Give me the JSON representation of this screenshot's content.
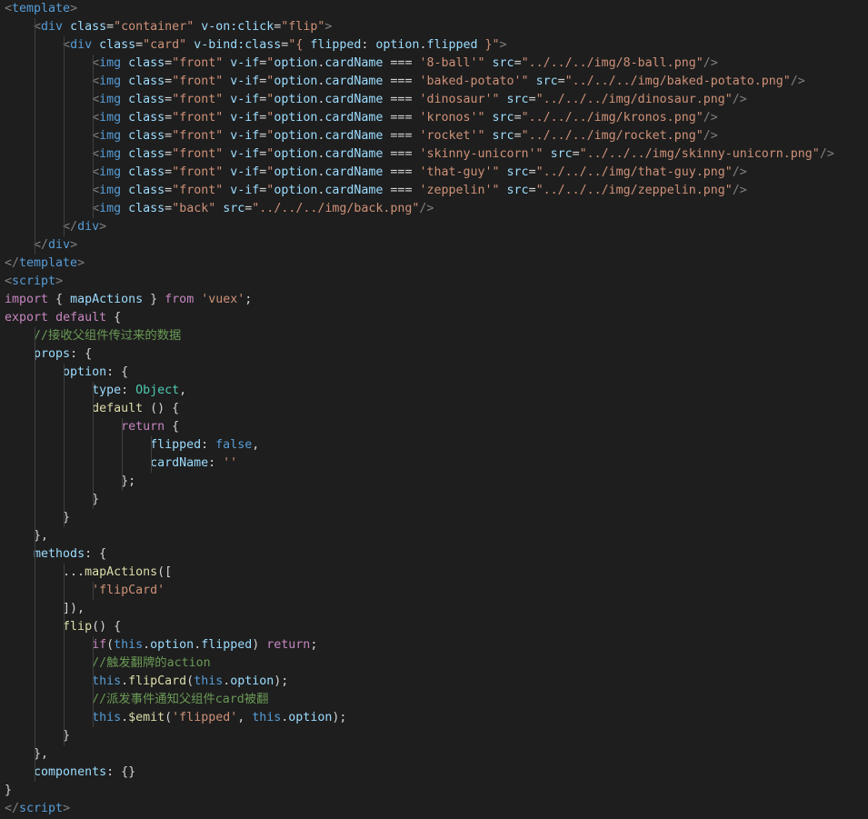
{
  "editor": {
    "theme": "dark",
    "background": "#1e1e1e",
    "lines": [
      [
        {
          "t": "<",
          "c": "p"
        },
        {
          "t": "template",
          "c": "k"
        },
        {
          "t": ">",
          "c": "p"
        }
      ],
      [
        {
          "t": "    "
        },
        {
          "t": "<",
          "c": "p"
        },
        {
          "t": "div",
          "c": "k"
        },
        {
          "t": " "
        },
        {
          "t": "class",
          "c": "a"
        },
        {
          "t": "="
        },
        {
          "t": "\"container\"",
          "c": "s"
        },
        {
          "t": " "
        },
        {
          "t": "v-on:click",
          "c": "a"
        },
        {
          "t": "="
        },
        {
          "t": "\"flip\"",
          "c": "s"
        },
        {
          "t": ">",
          "c": "p"
        }
      ],
      [
        {
          "t": "        "
        },
        {
          "t": "<",
          "c": "p"
        },
        {
          "t": "div",
          "c": "k"
        },
        {
          "t": " "
        },
        {
          "t": "class",
          "c": "a"
        },
        {
          "t": "="
        },
        {
          "t": "\"card\"",
          "c": "s"
        },
        {
          "t": " "
        },
        {
          "t": "v-bind:class",
          "c": "a"
        },
        {
          "t": "="
        },
        {
          "t": "\"{ ",
          "c": "s"
        },
        {
          "t": "flipped",
          "c": "a"
        },
        {
          "t": ": ",
          "c": "d"
        },
        {
          "t": "option",
          "c": "a"
        },
        {
          "t": ".",
          "c": "d"
        },
        {
          "t": "flipped",
          "c": "a"
        },
        {
          "t": " }\"",
          "c": "s"
        },
        {
          "t": ">",
          "c": "p"
        }
      ],
      [
        {
          "t": "            "
        },
        {
          "t": "<",
          "c": "p"
        },
        {
          "t": "img",
          "c": "k"
        },
        {
          "t": " "
        },
        {
          "t": "class",
          "c": "a"
        },
        {
          "t": "="
        },
        {
          "t": "\"front\"",
          "c": "s"
        },
        {
          "t": " "
        },
        {
          "t": "v-if",
          "c": "a"
        },
        {
          "t": "="
        },
        {
          "t": "\"",
          "c": "s"
        },
        {
          "t": "option",
          "c": "a"
        },
        {
          "t": "."
        },
        {
          "t": "cardName",
          "c": "a"
        },
        {
          "t": " === "
        },
        {
          "t": "'8-ball'",
          "c": "s"
        },
        {
          "t": "\"",
          "c": "s"
        },
        {
          "t": " "
        },
        {
          "t": "src",
          "c": "a"
        },
        {
          "t": "="
        },
        {
          "t": "\"../../../img/8-ball.png\"",
          "c": "s"
        },
        {
          "t": "/>",
          "c": "p"
        }
      ],
      [
        {
          "t": "            "
        },
        {
          "t": "<",
          "c": "p"
        },
        {
          "t": "img",
          "c": "k"
        },
        {
          "t": " "
        },
        {
          "t": "class",
          "c": "a"
        },
        {
          "t": "="
        },
        {
          "t": "\"front\"",
          "c": "s"
        },
        {
          "t": " "
        },
        {
          "t": "v-if",
          "c": "a"
        },
        {
          "t": "="
        },
        {
          "t": "\"",
          "c": "s"
        },
        {
          "t": "option",
          "c": "a"
        },
        {
          "t": "."
        },
        {
          "t": "cardName",
          "c": "a"
        },
        {
          "t": " === "
        },
        {
          "t": "'baked-potato'",
          "c": "s"
        },
        {
          "t": "\"",
          "c": "s"
        },
        {
          "t": " "
        },
        {
          "t": "src",
          "c": "a"
        },
        {
          "t": "="
        },
        {
          "t": "\"../../../img/baked-potato.png\"",
          "c": "s"
        },
        {
          "t": "/>",
          "c": "p"
        }
      ],
      [
        {
          "t": "            "
        },
        {
          "t": "<",
          "c": "p"
        },
        {
          "t": "img",
          "c": "k"
        },
        {
          "t": " "
        },
        {
          "t": "class",
          "c": "a"
        },
        {
          "t": "="
        },
        {
          "t": "\"front\"",
          "c": "s"
        },
        {
          "t": " "
        },
        {
          "t": "v-if",
          "c": "a"
        },
        {
          "t": "="
        },
        {
          "t": "\"",
          "c": "s"
        },
        {
          "t": "option",
          "c": "a"
        },
        {
          "t": "."
        },
        {
          "t": "cardName",
          "c": "a"
        },
        {
          "t": " === "
        },
        {
          "t": "'dinosaur'",
          "c": "s"
        },
        {
          "t": "\"",
          "c": "s"
        },
        {
          "t": " "
        },
        {
          "t": "src",
          "c": "a"
        },
        {
          "t": "="
        },
        {
          "t": "\"../../../img/dinosaur.png\"",
          "c": "s"
        },
        {
          "t": "/>",
          "c": "p"
        }
      ],
      [
        {
          "t": "            "
        },
        {
          "t": "<",
          "c": "p"
        },
        {
          "t": "img",
          "c": "k"
        },
        {
          "t": " "
        },
        {
          "t": "class",
          "c": "a"
        },
        {
          "t": "="
        },
        {
          "t": "\"front\"",
          "c": "s"
        },
        {
          "t": " "
        },
        {
          "t": "v-if",
          "c": "a"
        },
        {
          "t": "="
        },
        {
          "t": "\"",
          "c": "s"
        },
        {
          "t": "option",
          "c": "a"
        },
        {
          "t": "."
        },
        {
          "t": "cardName",
          "c": "a"
        },
        {
          "t": " === "
        },
        {
          "t": "'kronos'",
          "c": "s"
        },
        {
          "t": "\"",
          "c": "s"
        },
        {
          "t": " "
        },
        {
          "t": "src",
          "c": "a"
        },
        {
          "t": "="
        },
        {
          "t": "\"../../../img/kronos.png\"",
          "c": "s"
        },
        {
          "t": "/>",
          "c": "p"
        }
      ],
      [
        {
          "t": "            "
        },
        {
          "t": "<",
          "c": "p"
        },
        {
          "t": "img",
          "c": "k"
        },
        {
          "t": " "
        },
        {
          "t": "class",
          "c": "a"
        },
        {
          "t": "="
        },
        {
          "t": "\"front\"",
          "c": "s"
        },
        {
          "t": " "
        },
        {
          "t": "v-if",
          "c": "a"
        },
        {
          "t": "="
        },
        {
          "t": "\"",
          "c": "s"
        },
        {
          "t": "option",
          "c": "a"
        },
        {
          "t": "."
        },
        {
          "t": "cardName",
          "c": "a"
        },
        {
          "t": " === "
        },
        {
          "t": "'rocket'",
          "c": "s"
        },
        {
          "t": "\"",
          "c": "s"
        },
        {
          "t": " "
        },
        {
          "t": "src",
          "c": "a"
        },
        {
          "t": "="
        },
        {
          "t": "\"../../../img/rocket.png\"",
          "c": "s"
        },
        {
          "t": "/>",
          "c": "p"
        }
      ],
      [
        {
          "t": "            "
        },
        {
          "t": "<",
          "c": "p"
        },
        {
          "t": "img",
          "c": "k"
        },
        {
          "t": " "
        },
        {
          "t": "class",
          "c": "a"
        },
        {
          "t": "="
        },
        {
          "t": "\"front\"",
          "c": "s"
        },
        {
          "t": " "
        },
        {
          "t": "v-if",
          "c": "a"
        },
        {
          "t": "="
        },
        {
          "t": "\"",
          "c": "s"
        },
        {
          "t": "option",
          "c": "a"
        },
        {
          "t": "."
        },
        {
          "t": "cardName",
          "c": "a"
        },
        {
          "t": " === "
        },
        {
          "t": "'skinny-unicorn'",
          "c": "s"
        },
        {
          "t": "\"",
          "c": "s"
        },
        {
          "t": " "
        },
        {
          "t": "src",
          "c": "a"
        },
        {
          "t": "="
        },
        {
          "t": "\"../../../img/skinny-unicorn.png\"",
          "c": "s"
        },
        {
          "t": "/>",
          "c": "p"
        }
      ],
      [
        {
          "t": "            "
        },
        {
          "t": "<",
          "c": "p"
        },
        {
          "t": "img",
          "c": "k"
        },
        {
          "t": " "
        },
        {
          "t": "class",
          "c": "a"
        },
        {
          "t": "="
        },
        {
          "t": "\"front\"",
          "c": "s"
        },
        {
          "t": " "
        },
        {
          "t": "v-if",
          "c": "a"
        },
        {
          "t": "="
        },
        {
          "t": "\"",
          "c": "s"
        },
        {
          "t": "option",
          "c": "a"
        },
        {
          "t": "."
        },
        {
          "t": "cardName",
          "c": "a"
        },
        {
          "t": " === "
        },
        {
          "t": "'that-guy'",
          "c": "s"
        },
        {
          "t": "\"",
          "c": "s"
        },
        {
          "t": " "
        },
        {
          "t": "src",
          "c": "a"
        },
        {
          "t": "="
        },
        {
          "t": "\"../../../img/that-guy.png\"",
          "c": "s"
        },
        {
          "t": "/>",
          "c": "p"
        }
      ],
      [
        {
          "t": "            "
        },
        {
          "t": "<",
          "c": "p"
        },
        {
          "t": "img",
          "c": "k"
        },
        {
          "t": " "
        },
        {
          "t": "class",
          "c": "a"
        },
        {
          "t": "="
        },
        {
          "t": "\"front\"",
          "c": "s"
        },
        {
          "t": " "
        },
        {
          "t": "v-if",
          "c": "a"
        },
        {
          "t": "="
        },
        {
          "t": "\"",
          "c": "s"
        },
        {
          "t": "option",
          "c": "a"
        },
        {
          "t": "."
        },
        {
          "t": "cardName",
          "c": "a"
        },
        {
          "t": " === "
        },
        {
          "t": "'zeppelin'",
          "c": "s"
        },
        {
          "t": "\"",
          "c": "s"
        },
        {
          "t": " "
        },
        {
          "t": "src",
          "c": "a"
        },
        {
          "t": "="
        },
        {
          "t": "\"../../../img/zeppelin.png\"",
          "c": "s"
        },
        {
          "t": "/>",
          "c": "p"
        }
      ],
      [
        {
          "t": "            "
        },
        {
          "t": "<",
          "c": "p"
        },
        {
          "t": "img",
          "c": "k"
        },
        {
          "t": " "
        },
        {
          "t": "class",
          "c": "a"
        },
        {
          "t": "="
        },
        {
          "t": "\"back\"",
          "c": "s"
        },
        {
          "t": " "
        },
        {
          "t": "src",
          "c": "a"
        },
        {
          "t": "="
        },
        {
          "t": "\"../../../img/back.png\"",
          "c": "s"
        },
        {
          "t": "/>",
          "c": "p"
        }
      ],
      [
        {
          "t": "        "
        },
        {
          "t": "</",
          "c": "p"
        },
        {
          "t": "div",
          "c": "k"
        },
        {
          "t": ">",
          "c": "p"
        }
      ],
      [
        {
          "t": "    "
        },
        {
          "t": "</",
          "c": "p"
        },
        {
          "t": "div",
          "c": "k"
        },
        {
          "t": ">",
          "c": "p"
        }
      ],
      [
        {
          "t": "</",
          "c": "p"
        },
        {
          "t": "template",
          "c": "k"
        },
        {
          "t": ">",
          "c": "p"
        }
      ],
      [
        {
          "t": "<",
          "c": "p"
        },
        {
          "t": "script",
          "c": "k"
        },
        {
          "t": ">",
          "c": "p"
        }
      ],
      [
        {
          "t": "import",
          "c": "m"
        },
        {
          "t": " { "
        },
        {
          "t": "mapActions",
          "c": "a"
        },
        {
          "t": " } "
        },
        {
          "t": "from",
          "c": "m"
        },
        {
          "t": " "
        },
        {
          "t": "'vuex'",
          "c": "s"
        },
        {
          "t": ";"
        }
      ],
      [
        {
          "t": "export",
          "c": "m"
        },
        {
          "t": " "
        },
        {
          "t": "default",
          "c": "m"
        },
        {
          "t": " {"
        }
      ],
      [
        {
          "t": "    "
        },
        {
          "t": "//接收父组件传过来的数据",
          "c": "c"
        }
      ],
      [
        {
          "t": "    "
        },
        {
          "t": "props",
          "c": "a"
        },
        {
          "t": ": {"
        }
      ],
      [
        {
          "t": "        "
        },
        {
          "t": "option",
          "c": "a"
        },
        {
          "t": ": {"
        }
      ],
      [
        {
          "t": "            "
        },
        {
          "t": "type",
          "c": "a"
        },
        {
          "t": ": "
        },
        {
          "t": "Object",
          "c": "t"
        },
        {
          "t": ","
        }
      ],
      [
        {
          "t": "            "
        },
        {
          "t": "default",
          "c": "f"
        },
        {
          "t": " () {"
        }
      ],
      [
        {
          "t": "                "
        },
        {
          "t": "return",
          "c": "m"
        },
        {
          "t": " {"
        }
      ],
      [
        {
          "t": "                    "
        },
        {
          "t": "flipped",
          "c": "a"
        },
        {
          "t": ": "
        },
        {
          "t": "false",
          "c": "k"
        },
        {
          "t": ","
        }
      ],
      [
        {
          "t": "                    "
        },
        {
          "t": "cardName",
          "c": "a"
        },
        {
          "t": ": "
        },
        {
          "t": "''",
          "c": "s"
        }
      ],
      [
        {
          "t": "                };"
        }
      ],
      [
        {
          "t": "            }"
        }
      ],
      [
        {
          "t": "        }"
        }
      ],
      [
        {
          "t": "    },"
        }
      ],
      [
        {
          "t": "    "
        },
        {
          "t": "methods",
          "c": "a"
        },
        {
          "t": ": {"
        }
      ],
      [
        {
          "t": "        ..."
        },
        {
          "t": "mapActions",
          "c": "f"
        },
        {
          "t": "(["
        }
      ],
      [
        {
          "t": "            "
        },
        {
          "t": "'flipCard'",
          "c": "s"
        }
      ],
      [
        {
          "t": "        ]),"
        }
      ],
      [
        {
          "t": "        "
        },
        {
          "t": "flip",
          "c": "f"
        },
        {
          "t": "() {"
        }
      ],
      [
        {
          "t": "            "
        },
        {
          "t": "if",
          "c": "m"
        },
        {
          "t": "("
        },
        {
          "t": "this",
          "c": "k"
        },
        {
          "t": "."
        },
        {
          "t": "option",
          "c": "a"
        },
        {
          "t": "."
        },
        {
          "t": "flipped",
          "c": "a"
        },
        {
          "t": ") "
        },
        {
          "t": "return",
          "c": "m"
        },
        {
          "t": ";"
        }
      ],
      [
        {
          "t": "            "
        },
        {
          "t": "//触发翻牌的action",
          "c": "c"
        }
      ],
      [
        {
          "t": "            "
        },
        {
          "t": "this",
          "c": "k"
        },
        {
          "t": "."
        },
        {
          "t": "flipCard",
          "c": "f"
        },
        {
          "t": "("
        },
        {
          "t": "this",
          "c": "k"
        },
        {
          "t": "."
        },
        {
          "t": "option",
          "c": "a"
        },
        {
          "t": ");"
        }
      ],
      [
        {
          "t": "            "
        },
        {
          "t": "//派发事件通知父组件card被翻",
          "c": "c"
        }
      ],
      [
        {
          "t": "            "
        },
        {
          "t": "this",
          "c": "k"
        },
        {
          "t": "."
        },
        {
          "t": "$emit",
          "c": "f"
        },
        {
          "t": "("
        },
        {
          "t": "'flipped'",
          "c": "s"
        },
        {
          "t": ", "
        },
        {
          "t": "this",
          "c": "k"
        },
        {
          "t": "."
        },
        {
          "t": "option",
          "c": "a"
        },
        {
          "t": ");"
        }
      ],
      [
        {
          "t": "        }"
        }
      ],
      [
        {
          "t": "    },"
        }
      ],
      [
        {
          "t": "    "
        },
        {
          "t": "components",
          "c": "a"
        },
        {
          "t": ": {}"
        }
      ],
      [
        {
          "t": "}"
        }
      ],
      [
        {
          "t": "</",
          "c": "p"
        },
        {
          "t": "script",
          "c": "k"
        },
        {
          "t": ">",
          "c": "p"
        }
      ]
    ]
  }
}
